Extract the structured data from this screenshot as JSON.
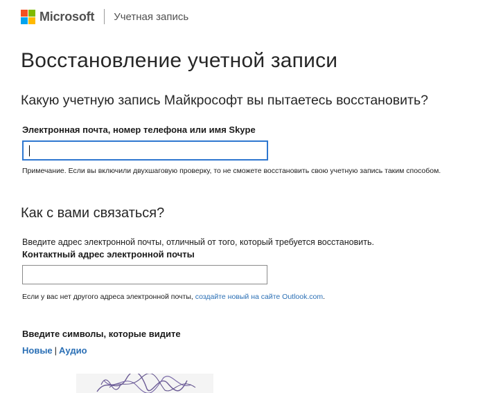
{
  "header": {
    "brand": "Microsoft",
    "section": "Учетная запись",
    "logo_colors": [
      "#f25022",
      "#7fba00",
      "#00a4ef",
      "#ffb900"
    ]
  },
  "page_title": "Восстановление учетной записи",
  "question": "Какую учетную запись Майкрософт вы пытаетесь восстановить?",
  "account_field": {
    "label": "Электронная почта, номер телефона или имя Skype",
    "value": "",
    "note": "Примечание. Если вы включили двухшаговую проверку, то не сможете восстановить свою учетную запись таким способом."
  },
  "contact_section": {
    "heading": "Как с вами связаться?",
    "description": "Введите адрес электронной почты, отличный от того, который требуется восстановить.",
    "label": "Контактный адрес электронной почты",
    "value": "",
    "note_prefix": "Если у вас нет другого адреса электронной почты,",
    "note_link": "создайте новый на сайте Outlook.com",
    "note_suffix": "."
  },
  "captcha": {
    "label": "Введите символы, которые видите",
    "new_link": "Новые",
    "separator": "|",
    "audio_link": "Аудио"
  },
  "colors": {
    "link": "#2a6fb5",
    "focus_border": "#2e77d0"
  }
}
